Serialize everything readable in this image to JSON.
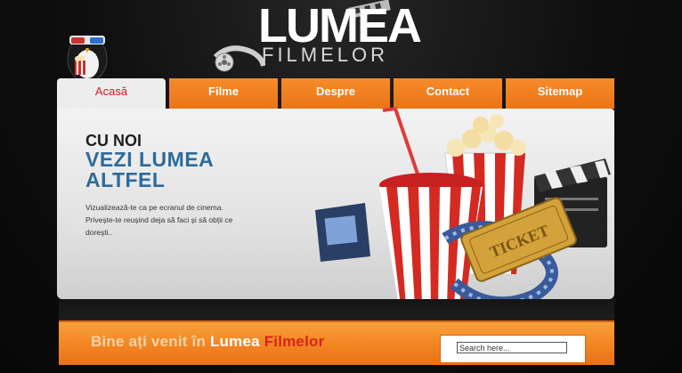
{
  "logo": {
    "title": "LUMEA",
    "subtitle": "FILMELOR"
  },
  "nav": {
    "items": [
      {
        "label": "Acasă",
        "active": true
      },
      {
        "label": "Filme",
        "active": false
      },
      {
        "label": "Despre",
        "active": false
      },
      {
        "label": "Contact",
        "active": false
      },
      {
        "label": "Sitemap",
        "active": false
      }
    ]
  },
  "hero": {
    "kicker": "CU NOI",
    "title": "VEZI LUMEA ALTFEL",
    "text": "Vizualizează-te ca pe ecranul de cinema. Privește-te reușind deja să faci și să obții ce dorești..",
    "ticket_label": "TICKET"
  },
  "welcome": {
    "part1": "Bine ați venit în ",
    "part2": "Lumea ",
    "part3": "Filmelor"
  },
  "search": {
    "placeholder": "Search here..."
  },
  "colors": {
    "orange": "#f07d1e",
    "active_text": "#d21c1c",
    "title_blue": "#2d6b9c",
    "background": "#0d0d0d"
  }
}
